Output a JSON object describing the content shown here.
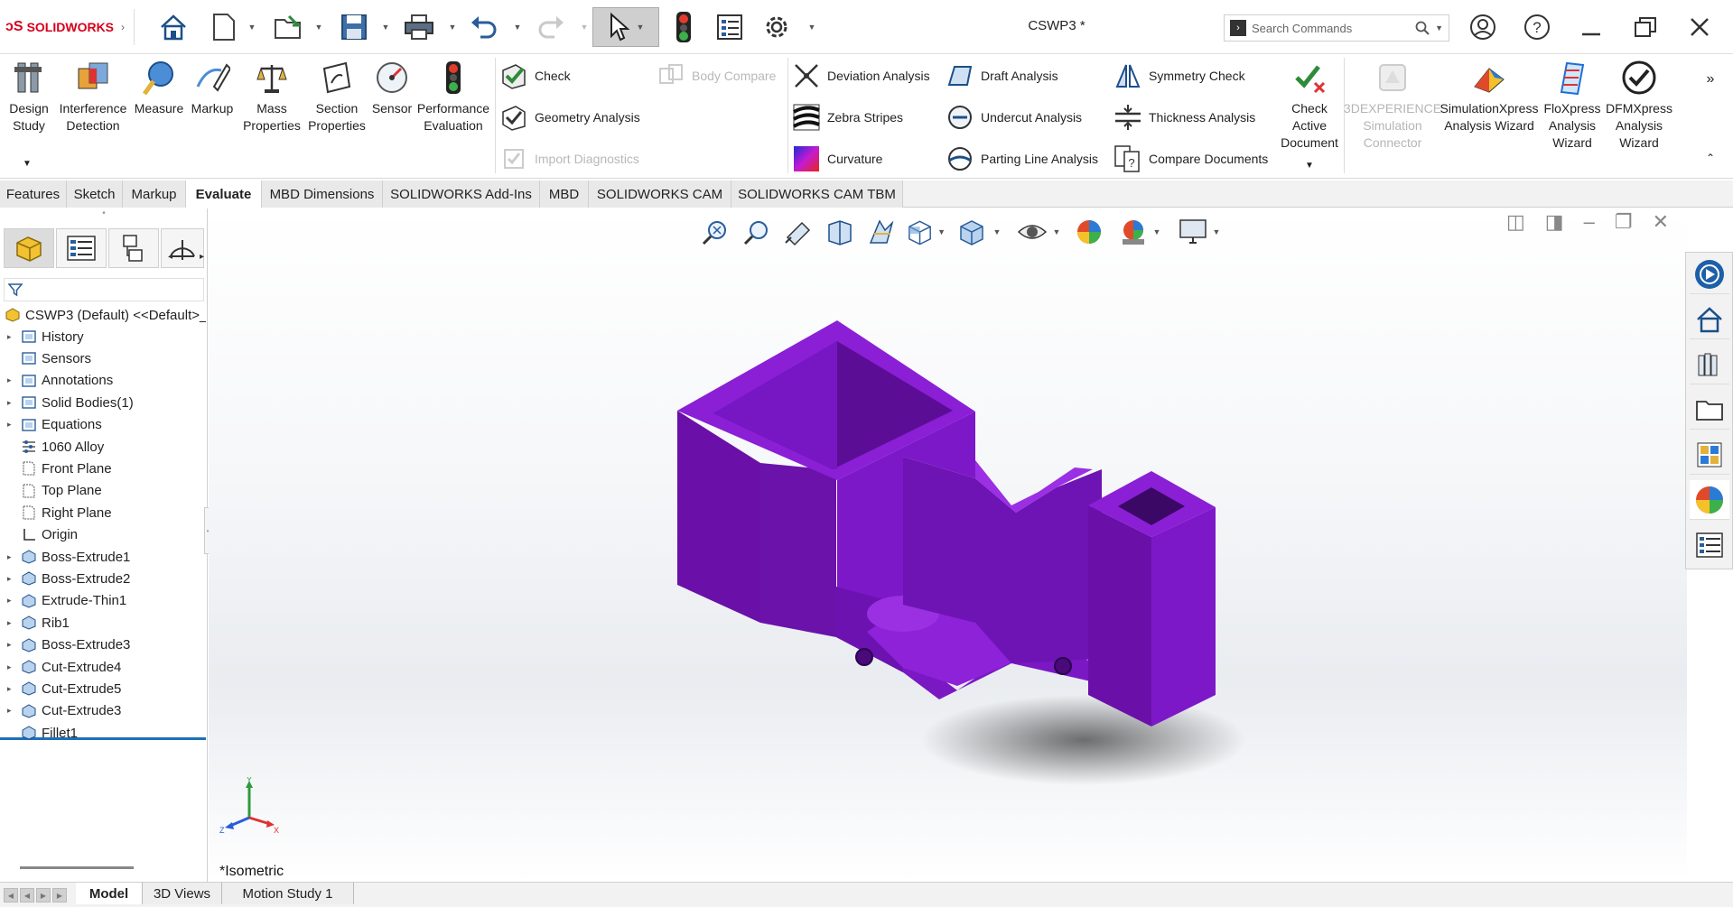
{
  "app": {
    "logo_text": "SOLIDWORKS",
    "doc_title": "CSWP3 *"
  },
  "search": {
    "placeholder": "Search Commands"
  },
  "ribbon": {
    "big_buttons": [
      {
        "label": "Design\nStudy",
        "icon": "design-study-icon"
      },
      {
        "label": "Interference\nDetection",
        "icon": "interference-icon"
      },
      {
        "label": "Measure",
        "icon": "measure-icon"
      },
      {
        "label": "Markup",
        "icon": "markup-icon"
      },
      {
        "label": "Mass\nProperties",
        "icon": "scale-icon"
      },
      {
        "label": "Section\nProperties",
        "icon": "section-icon"
      },
      {
        "label": "Sensor",
        "icon": "sensor-icon"
      },
      {
        "label": "Performance\nEvaluation",
        "icon": "traffic-light-icon"
      }
    ],
    "small_col1": {
      "check": "Check",
      "geometry": "Geometry Analysis",
      "import_diag": "Import Diagnostics",
      "body_compare": "Body Compare"
    },
    "small_col2": {
      "deviation": "Deviation Analysis",
      "zebra": "Zebra Stripes",
      "curvature": "Curvature"
    },
    "small_col3": {
      "draft": "Draft Analysis",
      "undercut": "Undercut Analysis",
      "parting": "Parting Line Analysis"
    },
    "small_col4": {
      "symmetry": "Symmetry Check",
      "thickness": "Thickness Analysis",
      "compare": "Compare Documents"
    },
    "check_active": "Check\nActive\nDocument",
    "right_big": [
      {
        "label": "3DEXPERIENCE\nSimulation\nConnector",
        "disabled": true
      },
      {
        "label": "SimulationXpress\nAnalysis Wizard",
        "disabled": false
      },
      {
        "label": "FloXpress\nAnalysis\nWizard",
        "disabled": false
      },
      {
        "label": "DFMXpress\nAnalysis\nWizard",
        "disabled": false
      }
    ]
  },
  "tabs": [
    "Features",
    "Sketch",
    "Markup",
    "Evaluate",
    "MBD Dimensions",
    "SOLIDWORKS Add-Ins",
    "MBD",
    "SOLIDWORKS CAM",
    "SOLIDWORKS CAM TBM"
  ],
  "active_tab": "Evaluate",
  "tree": {
    "root": "CSWP3  (Default) <<Default>_",
    "items": [
      {
        "label": "History",
        "expandable": true
      },
      {
        "label": "Sensors",
        "expandable": false
      },
      {
        "label": "Annotations",
        "expandable": true
      },
      {
        "label": "Solid Bodies(1)",
        "expandable": true
      },
      {
        "label": "Equations",
        "expandable": true
      },
      {
        "label": "1060 Alloy",
        "expandable": false
      },
      {
        "label": "Front Plane",
        "expandable": false
      },
      {
        "label": "Top Plane",
        "expandable": false
      },
      {
        "label": "Right Plane",
        "expandable": false
      },
      {
        "label": "Origin",
        "expandable": false
      },
      {
        "label": "Boss-Extrude1",
        "expandable": true
      },
      {
        "label": "Boss-Extrude2",
        "expandable": true
      },
      {
        "label": "Extrude-Thin1",
        "expandable": true
      },
      {
        "label": "Rib1",
        "expandable": true
      },
      {
        "label": "Boss-Extrude3",
        "expandable": true
      },
      {
        "label": "Cut-Extrude4",
        "expandable": true
      },
      {
        "label": "Cut-Extrude5",
        "expandable": true
      },
      {
        "label": "Cut-Extrude3",
        "expandable": true
      },
      {
        "label": "Fillet1",
        "expandable": false
      }
    ]
  },
  "viewport": {
    "view_label": "*Isometric",
    "model_color": "#7a16c0",
    "axis": {
      "x": "X",
      "y": "Y",
      "z": "Z"
    }
  },
  "status_tabs": [
    "Model",
    "3D Views",
    "Motion Study 1"
  ],
  "active_status_tab": "Model"
}
